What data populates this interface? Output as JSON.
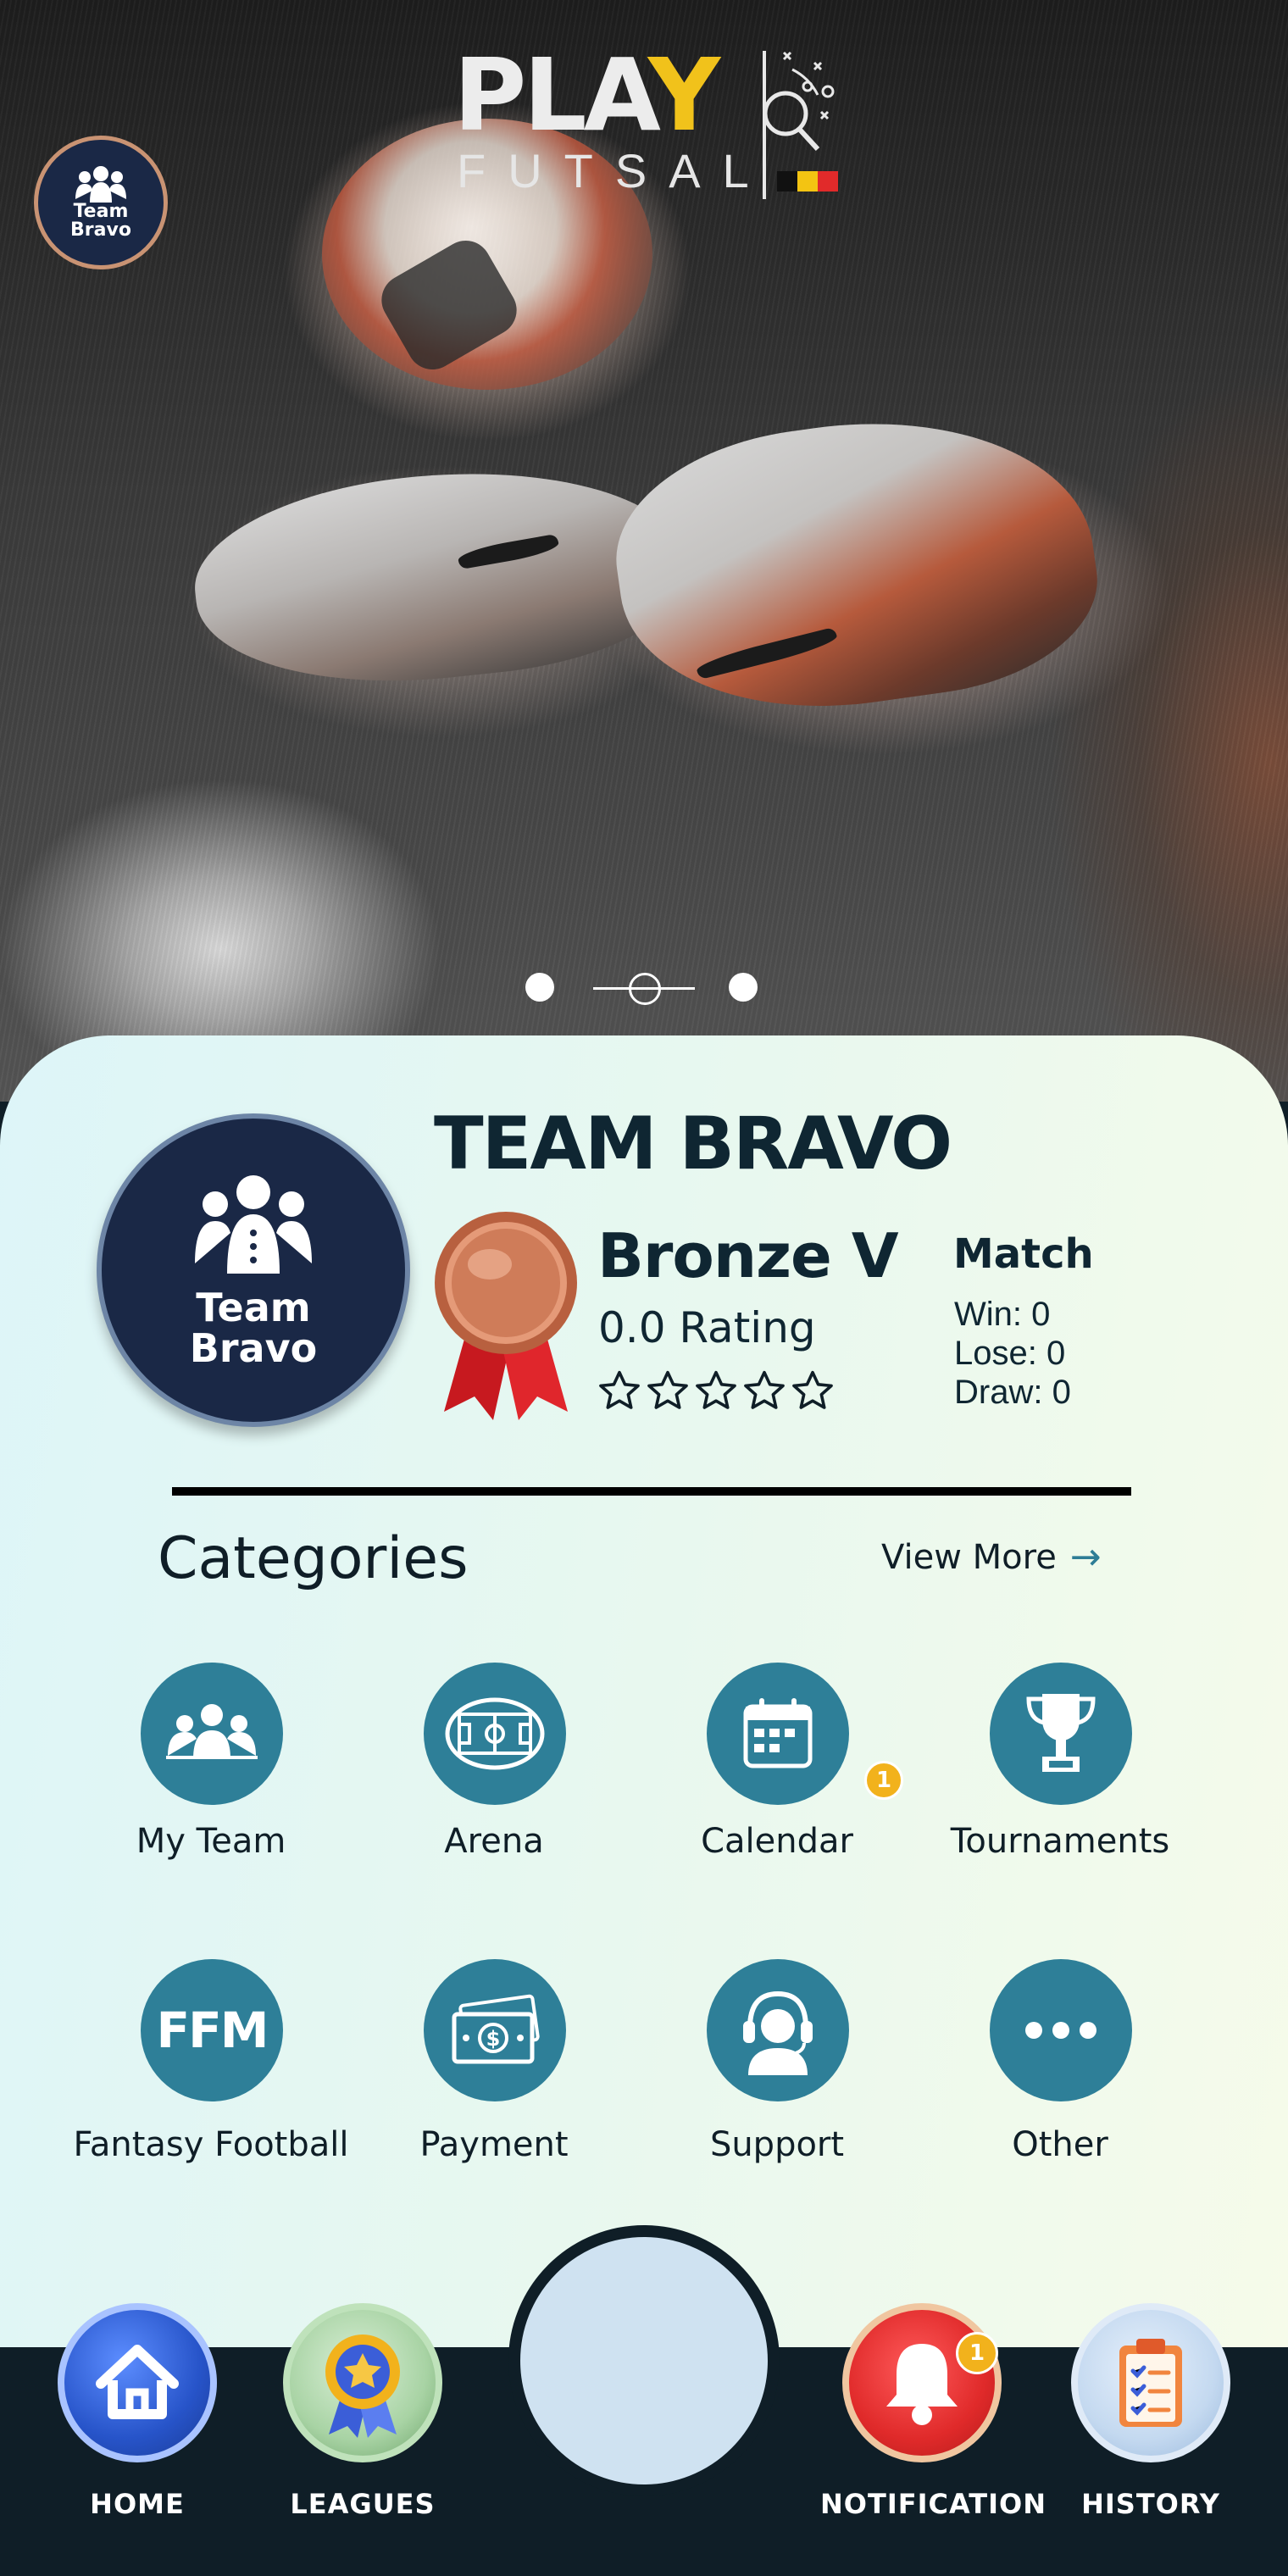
{
  "app": {
    "logo_main": "PLAY",
    "logo_sub": "FUTSAL"
  },
  "team": {
    "avatar_text_line1": "Team",
    "avatar_text_line2": "Bravo",
    "name": "TEAM BRAVO",
    "rank": "Bronze V",
    "rating": "0.0 Rating",
    "stars_filled": 0,
    "stars_total": 5
  },
  "match": {
    "title": "Match",
    "win": "Win: 0",
    "lose": "Lose: 0",
    "draw": "Draw: 0"
  },
  "carousel": {
    "slides": 3,
    "active_index": 1
  },
  "categories": {
    "title": "Categories",
    "view_more": "View More",
    "items": [
      {
        "label": "My Team",
        "icon": "team-icon"
      },
      {
        "label": "Arena",
        "icon": "arena-icon"
      },
      {
        "label": "Calendar",
        "icon": "calendar-icon",
        "badge": "1"
      },
      {
        "label": "Tournaments",
        "icon": "trophy-icon"
      },
      {
        "label": "Fantasy Football",
        "icon": "ffm-icon",
        "icon_text": "FFM"
      },
      {
        "label": "Payment",
        "icon": "payment-icon"
      },
      {
        "label": "Support",
        "icon": "support-icon"
      },
      {
        "label": "Other",
        "icon": "more-icon"
      }
    ]
  },
  "nav": {
    "items": [
      {
        "label": "HOME",
        "icon": "home-icon"
      },
      {
        "label": "LEAGUES",
        "icon": "leagues-icon"
      },
      {
        "label": "NOTIFICATION",
        "icon": "bell-icon",
        "badge": "1"
      },
      {
        "label": "HISTORY",
        "icon": "history-icon"
      }
    ]
  },
  "colors": {
    "accent": "#2e7f98",
    "dark": "#0f1e27",
    "badge": "#f2b21c",
    "team_navy": "#1a2846"
  }
}
